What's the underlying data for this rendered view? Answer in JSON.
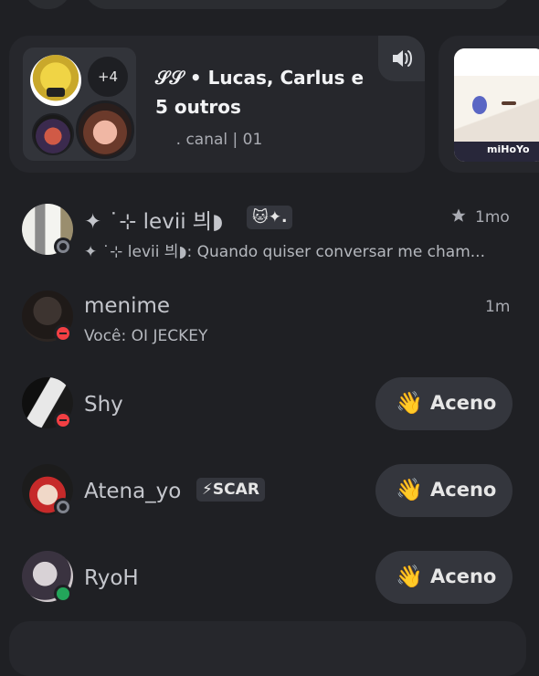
{
  "voice_card": {
    "title": "𝒮𝒮 • Lucas, Carlus e 5 outros",
    "subtitle": "ﾠ. canal | 01",
    "extra_count": "+4",
    "speaker_icon": "speaker-icon"
  },
  "card2": {
    "logo_text": "miHoYo"
  },
  "dms": [
    {
      "name": "✦ ˙⊹ levii 븨◗",
      "tag": "🐱✦.",
      "time": "1mo",
      "time_icon": "star-icon",
      "preview": "✦ ˙⊹ levii 븨◗: Quando quiser conversar me cham...",
      "status": "offline"
    },
    {
      "name": "menime",
      "time": "1m",
      "preview": "Você: OI JECKEY",
      "status": "dnd"
    },
    {
      "name": "Shy",
      "status": "dnd",
      "wave_label": "Aceno",
      "wave_emoji": "👋"
    },
    {
      "name": "Atena_yo",
      "tag": "⚡SCAR",
      "status": "offline",
      "wave_label": "Aceno",
      "wave_emoji": "👋"
    },
    {
      "name": "RyoH",
      "status": "online",
      "wave_label": "Aceno",
      "wave_emoji": "👋"
    }
  ]
}
